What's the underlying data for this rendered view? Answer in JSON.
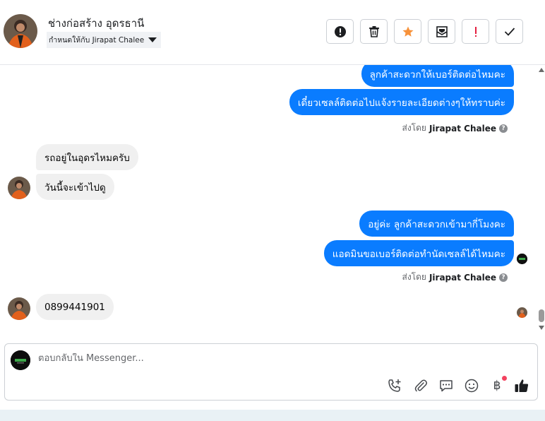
{
  "header": {
    "title": "ช่างก่อสร้าง อุดรธานี",
    "assigned_label": "กำหนดให้กับ Jirapat Chalee",
    "actions": [
      {
        "name": "report-button",
        "icon": "alert-circle-icon"
      },
      {
        "name": "delete-button",
        "icon": "trash-icon"
      },
      {
        "name": "star-button",
        "icon": "star-icon"
      },
      {
        "name": "mark-unread-button",
        "icon": "envelope-icon"
      },
      {
        "name": "flag-button",
        "icon": "exclamation-icon"
      },
      {
        "name": "mark-done-button",
        "icon": "check-icon"
      }
    ]
  },
  "messages": [
    {
      "from": "page",
      "text": "ลูกค้าสะดวกให้เบอร์ติดต่อไหมคะ"
    },
    {
      "from": "page",
      "text": "เดี๋ยวเซลล์ติดต่อไปแจ้งรายละเอียดต่างๆให้ทราบค่ะ"
    },
    {
      "from": "customer",
      "text": "รถอยู่ในอุดรไหมครับ"
    },
    {
      "from": "customer",
      "text": "วันนี้จะเข้าไปดู"
    },
    {
      "from": "page",
      "text": "อยู่ค่ะ ลูกค้าสะดวกเข้ามากี่โมงคะ"
    },
    {
      "from": "page",
      "text": "แอดมินขอเบอร์ติดต่อทำนัดเซลล์ได้ไหมคะ"
    },
    {
      "from": "customer",
      "text": "0899441901"
    }
  ],
  "sent_by": {
    "prefix": "ส่งโดย",
    "name": "Jirapat Chalee",
    "help_icon": "?"
  },
  "composer": {
    "placeholder": "ตอบกลับใน Messenger...",
    "icons": [
      "call-add-icon",
      "attachment-icon",
      "saved-reply-icon",
      "emoji-icon",
      "baht-payment-icon",
      "thumbs-up-icon"
    ],
    "baht_symbol": "฿"
  },
  "colors": {
    "outgoing_bubble": "#0a7cff",
    "incoming_bubble": "#f0f0f0",
    "star": "#f7923a",
    "flag": "#e41e3f",
    "notification_dot": "#f3425f"
  }
}
